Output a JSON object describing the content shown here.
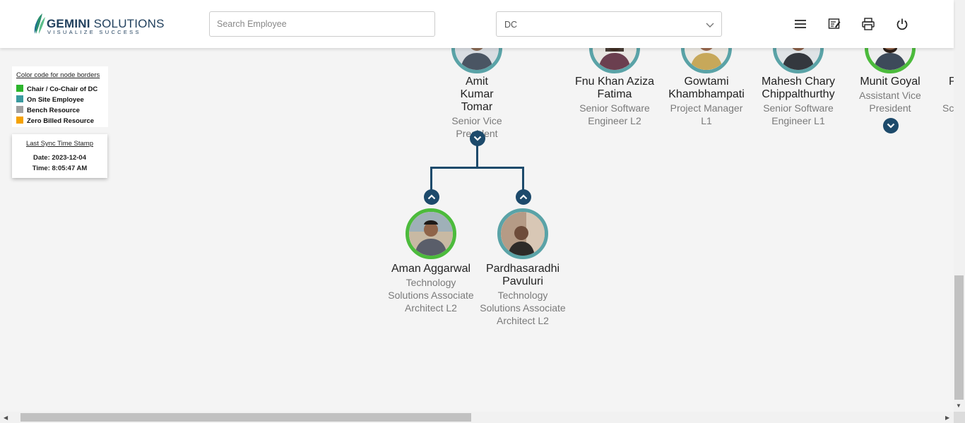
{
  "header": {
    "logo": {
      "brand_bold": "GEMINI",
      "brand_rest": " SOLUTIONS",
      "tagline": "VISUALIZE SUCCESS"
    },
    "search": {
      "placeholder": "Search Employee",
      "value": ""
    },
    "dc_select": {
      "value": "DC"
    },
    "icons": [
      "menu-icon",
      "notes-icon",
      "print-icon",
      "power-icon"
    ]
  },
  "legend": {
    "title": "Color code for node borders",
    "items": [
      {
        "label": "Chair / Co-Chair of DC",
        "color": "#2db52d"
      },
      {
        "label": "On Site Employee",
        "color": "#3a9a9f"
      },
      {
        "label": "Bench Resource",
        "color": "#a0a0a0"
      },
      {
        "label": "Zero Billed Resource",
        "color": "#f5a200"
      }
    ]
  },
  "sync": {
    "title": "Last Sync Time Stamp",
    "date": "Date: 2023-12-04",
    "time": "Time: 8:05:47 AM"
  },
  "colors": {
    "chair": "#4cbb3c",
    "onsite": "#5aa3a7",
    "connector": "#1d4a6b"
  },
  "top_nodes": [
    {
      "name": "Amit Kumar Tomar",
      "role": "Senior Vice President",
      "border": "onsite",
      "expand": true
    },
    {
      "name": "Fnu Khan Aziza Fatima",
      "role": "Senior Software Engineer L2",
      "border": "onsite",
      "expand": false
    },
    {
      "name": "Gowtami Khambhampati",
      "role": "Project Manager L1",
      "border": "onsite",
      "expand": false
    },
    {
      "name": "Mahesh Chary Chippalthurthy",
      "role": "Senior Software Engineer L1",
      "border": "onsite",
      "expand": false
    },
    {
      "name": "Munit Goyal",
      "role": "Assistant Vice President",
      "border": "chair",
      "expand": true
    },
    {
      "name": "P",
      "role": "Sc",
      "border": "onsite",
      "expand": false
    }
  ],
  "child_nodes": [
    {
      "name": "Aman Aggarwal",
      "role": "Technology Solutions Associate Architect L2",
      "border": "chair"
    },
    {
      "name": "Pardhasaradhi Pavuluri",
      "role": "Technology Solutions Associate Architect L2",
      "border": "onsite"
    }
  ]
}
